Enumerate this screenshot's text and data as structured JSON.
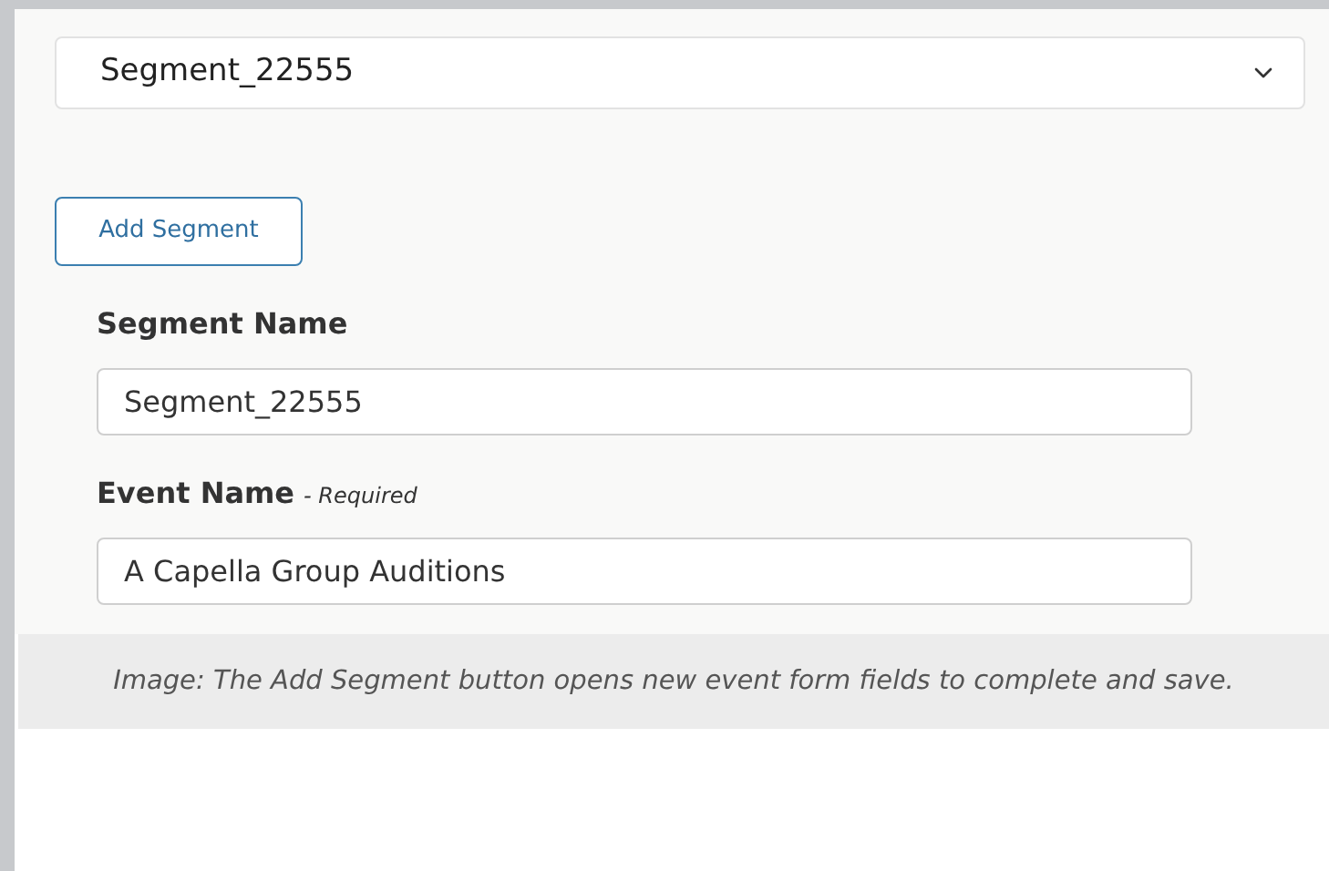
{
  "segment_select": {
    "value": "Segment_22555"
  },
  "add_button": {
    "label": "Add Segment"
  },
  "fields": [
    {
      "label": "Segment Name",
      "value": "Segment_22555"
    },
    {
      "label": "Event Name",
      "note": "- Required",
      "value": "A Capella Group Auditions"
    }
  ],
  "caption": "Image: The Add Segment button opens new event form fields to complete and save."
}
